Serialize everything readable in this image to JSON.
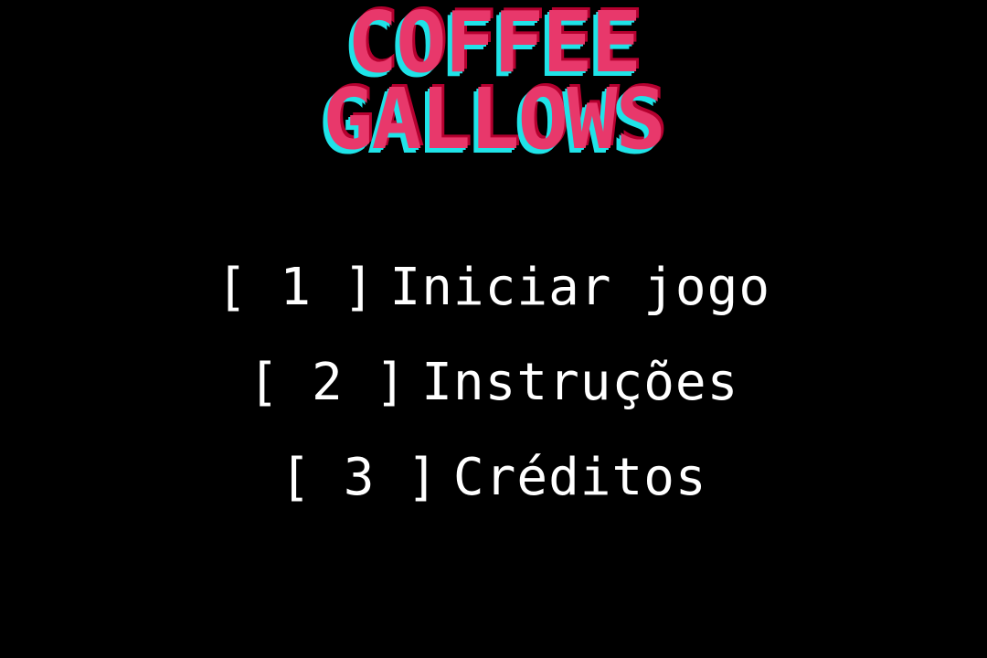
{
  "title": {
    "line1": "COFFEE",
    "line2": "GALLOWS"
  },
  "colors": {
    "background": "#000000",
    "title_fill": "#e8386b",
    "title_shadow_cyan": "#1fe3e8",
    "menu_text": "#ffffff"
  },
  "menu": {
    "items": [
      {
        "key": "[ 1 ]",
        "label": "Iniciar jogo"
      },
      {
        "key": "[ 2 ]",
        "label": "Instruções"
      },
      {
        "key": "[ 3 ]",
        "label": "Créditos"
      }
    ]
  }
}
